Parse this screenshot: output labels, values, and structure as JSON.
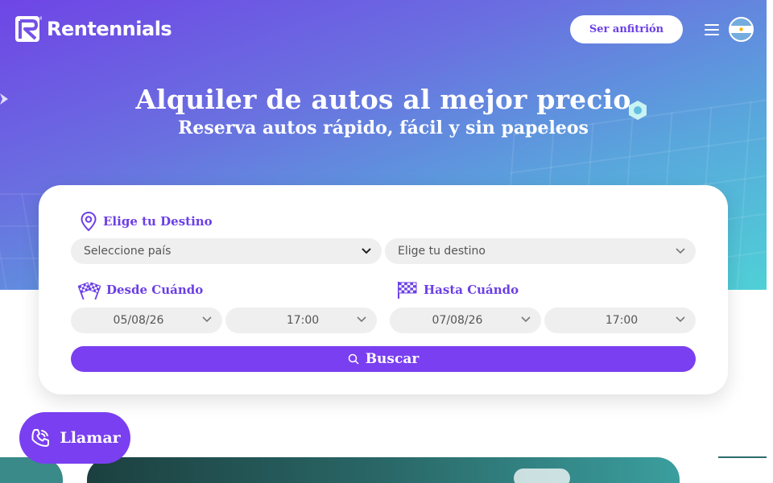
{
  "brand": {
    "name": "Rentennials",
    "registered": "®",
    "accent_color": "#7a3ff0",
    "hero_gradient": [
      "#6f45e6",
      "#58a9dc",
      "#4fd0d6"
    ]
  },
  "header": {
    "host_label": "Ser anfitrión",
    "menu_icon": "hamburger-icon",
    "flag_icon": "argentina-flag-icon"
  },
  "hero": {
    "title": "Alquiler de autos al mejor precio",
    "subtitle": "Reserva autos rápido, fácil y sin papeleos"
  },
  "search": {
    "destination": {
      "label": "Elige tu Destino",
      "icon": "location-pin-icon",
      "country_placeholder": "Seleccione país",
      "destination_placeholder": "Elige tu destino"
    },
    "from": {
      "label": "Desde Cuándo",
      "icon": "checkered-flags-icon",
      "date": "05/08/26",
      "time": "17:00"
    },
    "to": {
      "label": "Hasta Cuándo",
      "icon": "checkered-flag-icon",
      "date": "07/08/26",
      "time": "17:00"
    },
    "submit_label": "Buscar",
    "submit_icon": "search-icon"
  },
  "call": {
    "label": "Llamar",
    "icon": "phone-call-icon"
  }
}
